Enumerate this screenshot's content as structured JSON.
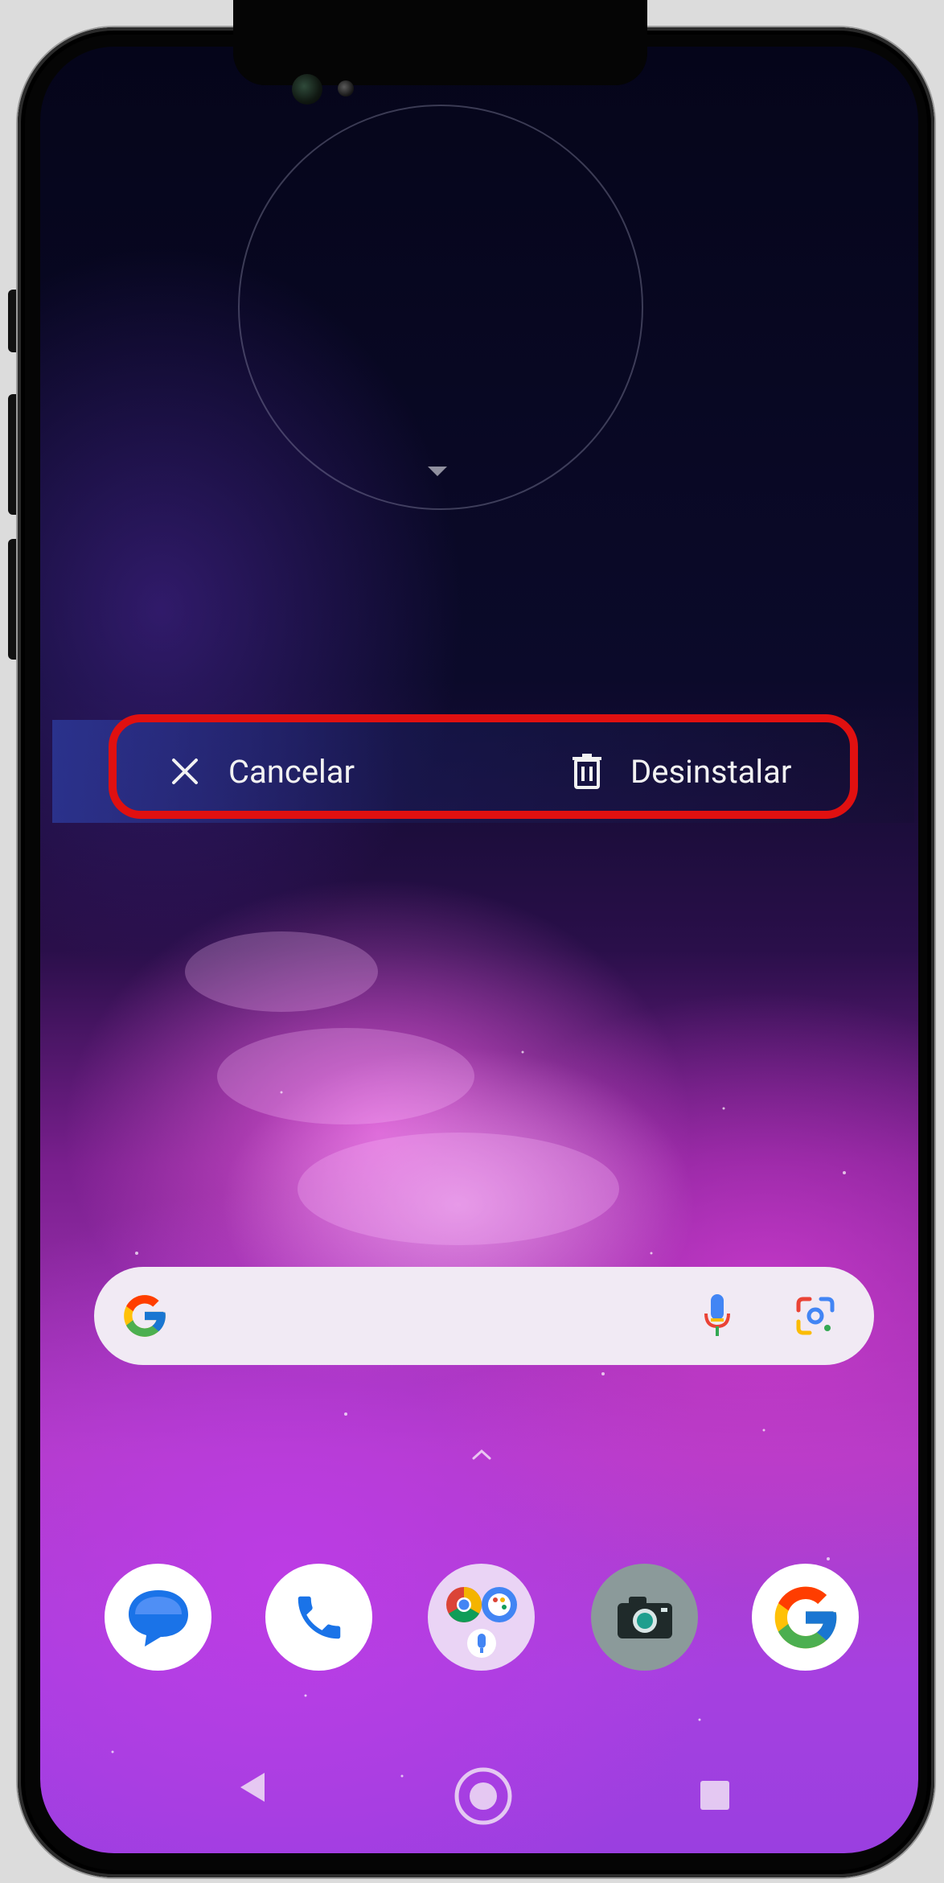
{
  "action_bar": {
    "cancel_label": "Cancelar",
    "uninstall_label": "Desinstalar",
    "highlight_color": "#e01010"
  },
  "search_bar": {
    "google_logo": "google-g-icon",
    "voice_icon": "mic-icon",
    "lens_icon": "google-lens-icon"
  },
  "dock": {
    "apps": [
      "messages-app-icon",
      "phone-app-icon",
      "chrome-google-folder-icon",
      "camera-app-icon",
      "google-app-icon"
    ]
  },
  "nav_bar": {
    "buttons": [
      "back-button",
      "home-button",
      "recents-button"
    ]
  },
  "wallpaper": "purple nebula"
}
